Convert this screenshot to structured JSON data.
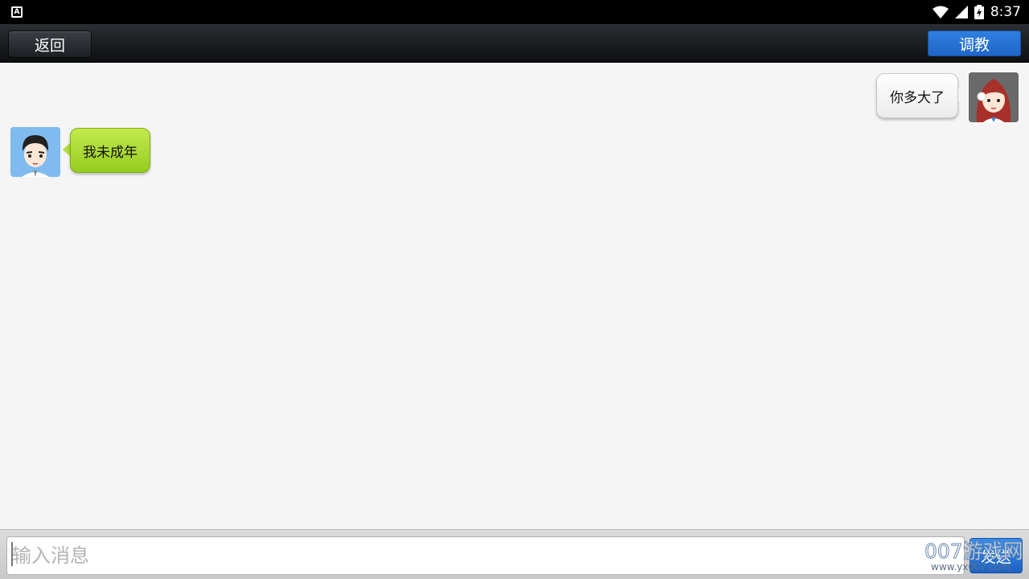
{
  "status_bar": {
    "app_indicator": "A",
    "time": "8:37",
    "icons": [
      "wifi-icon",
      "signal-icon",
      "battery-icon"
    ]
  },
  "top_bar": {
    "back_label": "返回",
    "train_label": "调教",
    "train_color": "#1f66c8"
  },
  "messages": [
    {
      "side": "right",
      "text": "你多大了",
      "sender_avatar": "girl-avatar",
      "bubble_color": "#ffffff"
    },
    {
      "side": "left",
      "text": "我未成年",
      "sender_avatar": "boy-avatar",
      "bubble_color": "#a8d633"
    }
  ],
  "input_bar": {
    "placeholder": "输入消息",
    "value": "",
    "send_label": "发送"
  },
  "watermark": {
    "brand": "007游戏网",
    "url": "www.yx007.com"
  }
}
